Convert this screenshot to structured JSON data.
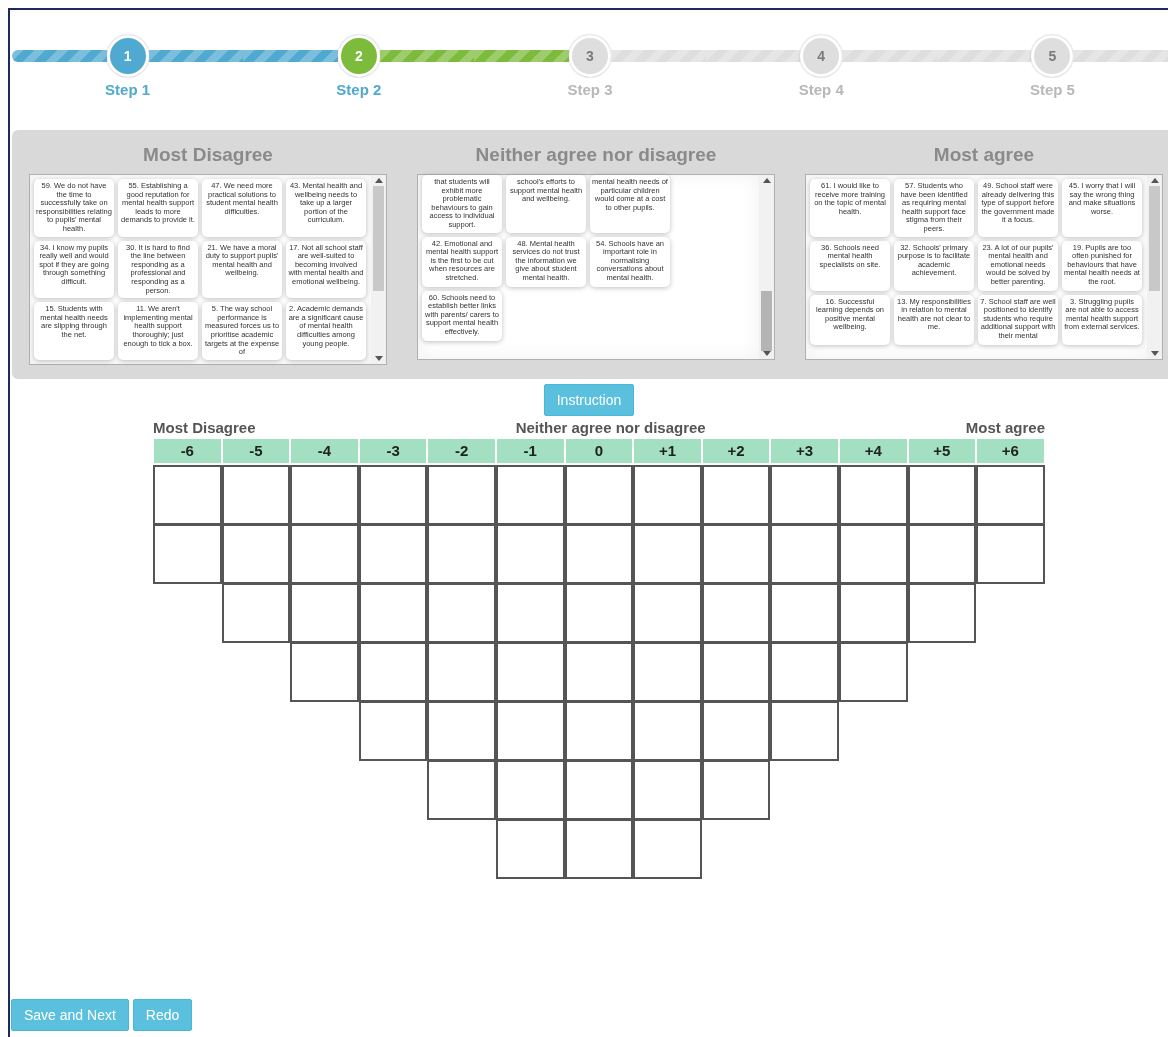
{
  "steps": [
    {
      "number": "1",
      "label": "Step 1",
      "completed": true,
      "selected": false
    },
    {
      "number": "2",
      "label": "Step 2",
      "completed": false,
      "selected": true
    },
    {
      "number": "3",
      "label": "Step 3",
      "completed": false,
      "selected": false
    },
    {
      "number": "4",
      "label": "Step 4",
      "completed": false,
      "selected": false
    },
    {
      "number": "5",
      "label": "Step 5",
      "completed": false,
      "selected": false
    }
  ],
  "panels": [
    {
      "title": "Most Disagree",
      "scrolled_to_bottom": false,
      "card_rows": [
        [
          "59. We do not have the time to successfully take on responsibilities relating to pupils' mental health.",
          "55. Establishing a good reputation for mental health support leads to more demands to provide it.",
          "47. We need more practical solutions to student mental health difficulties.",
          "43. Mental health and wellbeing needs to take up a larger portion of the curriculum."
        ],
        [
          "34. I know my pupils really well and would spot if they are going through something difficult.",
          "30. It is hard to find the line between responding as a professional and responding as a person.",
          "21. We have a moral duty to support pupils' mental health and wellbeing.",
          "17. Not all school staff are well-suited to becoming involved with mental health and emotional wellbeing."
        ],
        [
          "15. Students with mental health needs are slipping through the net.",
          "11. We aren't implementing mental health support thoroughly; just enough to tick a box.",
          "5. The way school performance is measured forces us to prioritise academic targets at the expense of",
          "2. Academic demands are a significant cause of mental health difficulties among young people."
        ]
      ]
    },
    {
      "title": "Neither agree nor disagree",
      "scrolled_to_bottom": true,
      "card_rows": [
        [
          "that students will exhibit more problematic behaviours to gain access to individual support.",
          "school's efforts to support mental health and wellbeing.",
          "mental health needs of particular children would come at a cost to other pupils."
        ],
        [
          "42. Emotional and mental health support is the first to be cut when resources are stretched.",
          "48. Mental health services do not trust the information we give about student mental health.",
          "54. Schools have an important role in normalising conversations about mental health."
        ],
        [
          "60. Schools need to establish better links with parents/ carers to support mental health effectively."
        ]
      ]
    },
    {
      "title": "Most agree",
      "scrolled_to_bottom": false,
      "card_rows": [
        [
          "61. I would like to receive more training on the topic of mental health.",
          "57. Students who have been identified as requiring mental health support face stigma from their peers.",
          "49. School staff were already delivering this type of support before the government made it a focus.",
          "45. I worry that I will say the wrong thing and make situations worse."
        ],
        [
          "36. Schools need mental health specialists on site.",
          "32. Schools' primary purpose is to facilitate academic achievement.",
          "23. A lot of our pupils' mental health and emotional needs would be solved by better parenting.",
          "19. Pupils are too often punished for behaviours that have mental health needs at the root."
        ],
        [
          "16. Successful learning depends on positive mental wellbeing.",
          "13. My responsibilities in relation to mental health are not clear to me.",
          "7. School staff are well positioned to identify students who require additional support with their mental",
          "3. Struggling pupils are not able to access mental health support from external services."
        ]
      ]
    }
  ],
  "instruction_button": "Instruction",
  "scale_labels": {
    "left": "Most Disagree",
    "middle": "Neither agree nor disagree",
    "right": "Most agree"
  },
  "grid": [
    {
      "label": "-6",
      "slots": [
        {
          "empty": true
        },
        {
          "empty": true
        }
      ]
    },
    {
      "label": "-5",
      "slots": [
        {
          "empty": true
        },
        {
          "empty": true
        },
        {
          "empty": true
        }
      ]
    },
    {
      "label": "-4",
      "slots": [
        {
          "empty": true
        },
        {
          "empty": true
        },
        {
          "empty": true
        },
        {
          "empty": true
        }
      ]
    },
    {
      "label": "-3",
      "slots": [
        {
          "empty": true
        },
        {
          "empty": true
        },
        {
          "empty": true
        },
        {
          "empty": true
        },
        {
          "empty": true
        }
      ]
    },
    {
      "label": "-2",
      "slots": [
        {
          "empty": true
        },
        {
          "empty": true
        },
        {
          "empty": true
        },
        {
          "empty": true
        },
        {
          "empty": true
        },
        {
          "empty": true
        }
      ]
    },
    {
      "label": "-1",
      "slots": [
        {
          "empty": true
        },
        {
          "empty": true
        },
        {
          "empty": true
        },
        {
          "empty": true
        },
        {
          "empty": true
        },
        {
          "empty": true
        },
        {
          "empty": true
        }
      ]
    },
    {
      "label": "0",
      "slots": [
        {
          "empty": true
        },
        {
          "empty": true
        },
        {
          "empty": true
        },
        {
          "empty": true
        },
        {
          "empty": true
        },
        {
          "empty": true
        },
        {
          "empty": true
        }
      ]
    },
    {
      "label": "+1",
      "slots": [
        {
          "empty": true
        },
        {
          "empty": true
        },
        {
          "empty": true
        },
        {
          "empty": true
        },
        {
          "empty": true
        },
        {
          "empty": true
        },
        {
          "empty": true
        }
      ]
    },
    {
      "label": "+2",
      "slots": [
        {
          "empty": true
        },
        {
          "empty": true
        },
        {
          "empty": true
        },
        {
          "empty": true
        },
        {
          "empty": true
        },
        {
          "empty": true
        }
      ]
    },
    {
      "label": "+3",
      "slots": [
        {
          "empty": true
        },
        {
          "empty": true
        },
        {
          "empty": true
        },
        {
          "empty": true
        },
        {
          "empty": true
        }
      ]
    },
    {
      "label": "+4",
      "slots": [
        {
          "empty": true
        },
        {
          "empty": true
        },
        {
          "empty": true
        },
        {
          "empty": true
        }
      ]
    },
    {
      "label": "+5",
      "slots": [
        {
          "empty": true
        },
        {
          "empty": true
        },
        {
          "empty": true
        }
      ]
    },
    {
      "label": "+6",
      "slots": [
        {
          "empty": true
        },
        {
          "empty": true
        }
      ]
    }
  ],
  "buttons": [
    "Save and Next",
    "Redo"
  ]
}
